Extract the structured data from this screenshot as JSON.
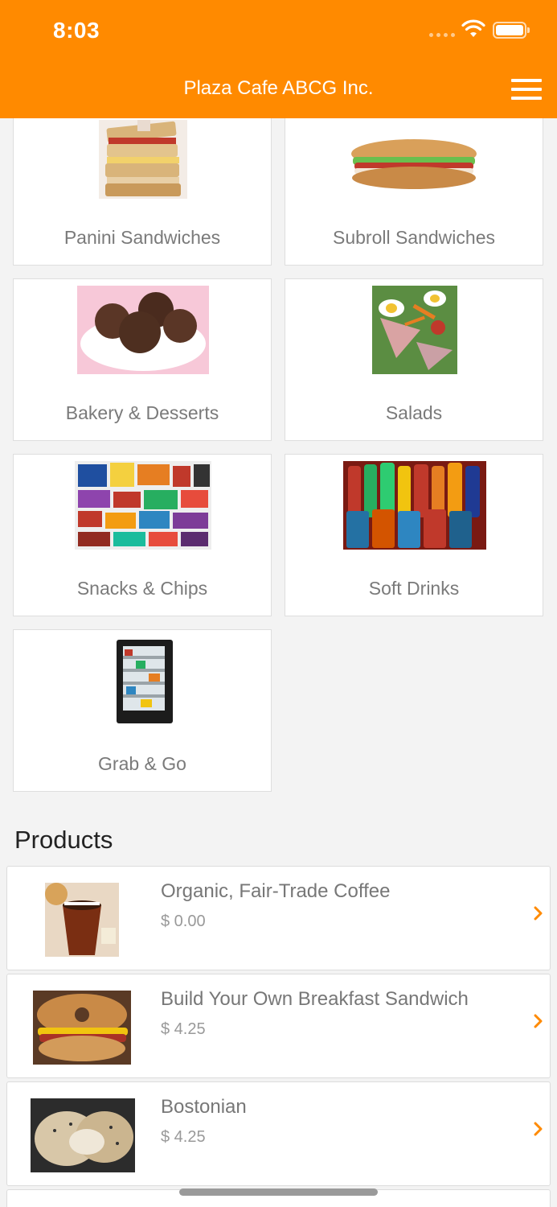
{
  "status_bar": {
    "time": "8:03"
  },
  "header": {
    "title": "Plaza Cafe ABCG Inc."
  },
  "categories": [
    {
      "label": "Panini Sandwiches"
    },
    {
      "label": "Subroll Sandwiches"
    },
    {
      "label": "Bakery & Desserts"
    },
    {
      "label": "Salads"
    },
    {
      "label": "Snacks & Chips"
    },
    {
      "label": "Soft Drinks"
    },
    {
      "label": "Grab & Go"
    }
  ],
  "products": {
    "heading": "Products",
    "items": [
      {
        "name": "Organic, Fair-Trade Coffee",
        "price": "$ 0.00"
      },
      {
        "name": "Build Your Own Breakfast Sandwich",
        "price": "$ 4.25"
      },
      {
        "name": "Bostonian",
        "price": "$ 4.25"
      }
    ]
  },
  "colors": {
    "accent": "#ff8a00",
    "background": "#f3f3f3",
    "card": "#ffffff"
  }
}
